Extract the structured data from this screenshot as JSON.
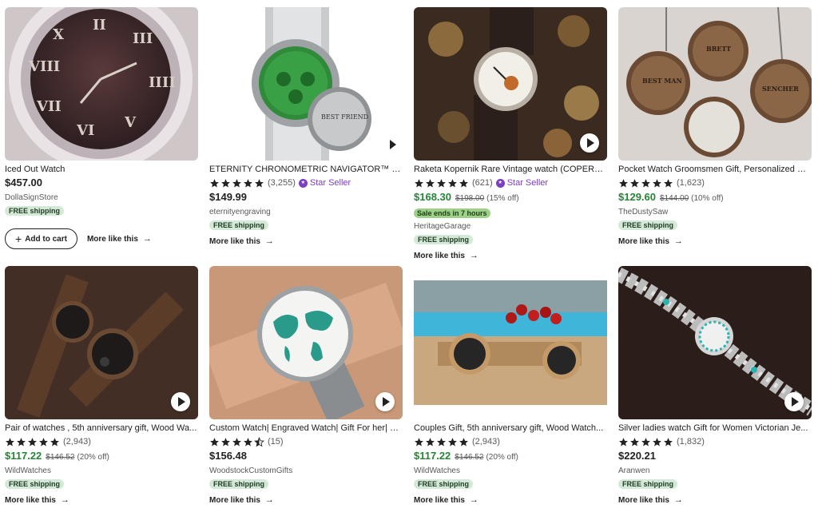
{
  "listings": [
    {
      "title": "Iced Out Watch",
      "rating_count": "",
      "star_seller": "",
      "price": "$457.00",
      "original_price": "",
      "discount": "",
      "sale_text": "",
      "shop": "DollaSignStore",
      "shipping": "FREE shipping",
      "more": "More like this",
      "add_to_cart": "Add to cart",
      "stars": 0
    },
    {
      "title": "ETERNITY CHRONOMETRIC NAVIGATOR™ Pers...",
      "rating_count": "(3,255)",
      "star_seller": "Star Seller",
      "price": "$149.99",
      "original_price": "",
      "discount": "",
      "sale_text": "",
      "shop": "eternityengraving",
      "shipping": "FREE shipping",
      "more": "More like this",
      "stars": 5
    },
    {
      "title": "Raketa Kopernik Rare Vintage watch (COPERNI...",
      "rating_count": "(621)",
      "star_seller": "Star Seller",
      "price": "$168.30",
      "original_price": "$198.00",
      "discount": "(15% off)",
      "sale_text": "Sale ends in 7 hours",
      "shop": "HeritageGarage",
      "shipping": "FREE shipping",
      "more": "More like this",
      "stars": 5
    },
    {
      "title": "Pocket Watch Groomsmen Gift, Personalized W...",
      "rating_count": "(1,623)",
      "star_seller": "",
      "price": "$129.60",
      "original_price": "$144.00",
      "discount": "(10% off)",
      "sale_text": "",
      "shop": "TheDustySaw",
      "shipping": "FREE shipping",
      "more": "More like this",
      "stars": 5
    },
    {
      "title": "Pair of watches , 5th anniversary gift, Wood Wa...",
      "rating_count": "(2,943)",
      "star_seller": "",
      "price": "$117.22",
      "original_price": "$146.52",
      "discount": "(20% off)",
      "sale_text": "",
      "shop": "WildWatches",
      "shipping": "FREE shipping",
      "more": "More like this",
      "stars": 5
    },
    {
      "title": "Custom Watch| Engraved Watch| Gift For her| B...",
      "rating_count": "(15)",
      "star_seller": "",
      "price": "$156.48",
      "original_price": "",
      "discount": "",
      "sale_text": "",
      "shop": "WoodstockCustomGifts",
      "shipping": "FREE shipping",
      "more": "More like this",
      "stars": 4.5
    },
    {
      "title": "Couples Gift, 5th anniversary gift, Wood Watch...",
      "rating_count": "(2,943)",
      "star_seller": "",
      "price": "$117.22",
      "original_price": "$146.52",
      "discount": "(20% off)",
      "sale_text": "",
      "shop": "WildWatches",
      "shipping": "FREE shipping",
      "more": "More like this",
      "stars": 5
    },
    {
      "title": "Silver ladies watch Gift for Women Victorian Je...",
      "rating_count": "(1,832)",
      "star_seller": "",
      "price": "$220.21",
      "original_price": "",
      "discount": "",
      "sale_text": "",
      "shop": "Aranwen",
      "shipping": "FREE shipping",
      "more": "More like this",
      "stars": 5
    }
  ],
  "colors": {
    "sale_green": "#258635",
    "star_seller_purple": "#7a3fc4",
    "shipping_badge": "#d4e9d7",
    "sale_badge": "#9ed08a"
  },
  "icons": {
    "star": "star-icon",
    "play": "play-icon",
    "arrow": "arrow-right-icon",
    "plus": "plus-icon",
    "star_seller_badge": "star-seller-badge-icon"
  }
}
